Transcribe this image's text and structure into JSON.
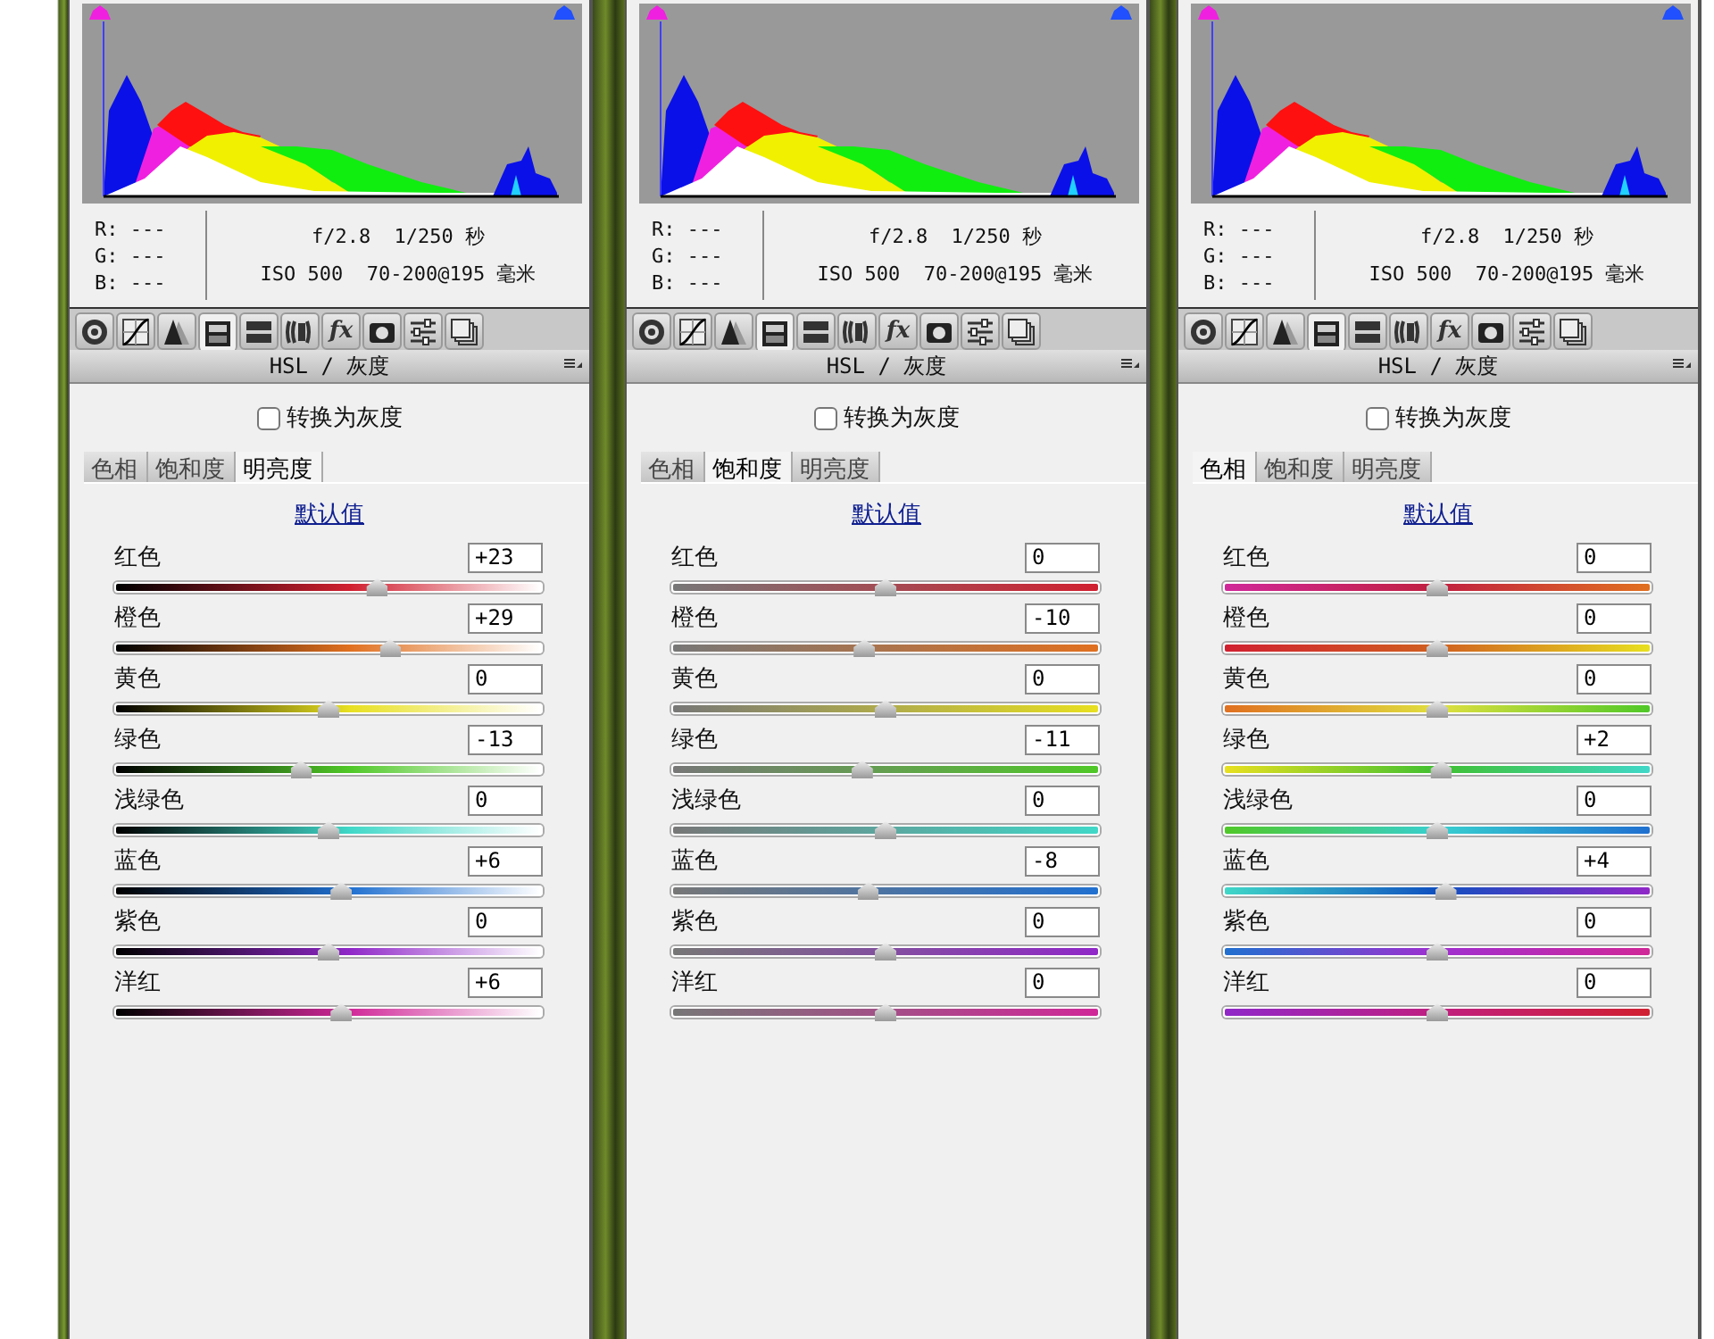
{
  "panels": [
    {
      "rgb": [
        "R: ---",
        "G: ---",
        "B: ---"
      ],
      "exposure": "f/2.8  1/250 秒",
      "camera": "ISO 500  70-200@195 毫米",
      "tools": [
        {
          "kind": "aperture",
          "selected": false
        },
        {
          "kind": "curve",
          "selected": false
        },
        {
          "kind": "peaks",
          "selected": false
        },
        {
          "kind": "hsl",
          "selected": true
        },
        {
          "kind": "split",
          "selected": false
        },
        {
          "kind": "lens",
          "selected": false
        },
        {
          "kind": "fx",
          "label": "fx",
          "selected": false
        },
        {
          "kind": "camera",
          "selected": false
        },
        {
          "kind": "presets",
          "selected": false
        },
        {
          "kind": "snapshots",
          "selected": false
        }
      ],
      "section_title": "HSL / 灰度",
      "grayscale": {
        "label": "转换为灰度",
        "checked": false
      },
      "tabs": [
        {
          "label": "色相",
          "selected": false
        },
        {
          "label": "饱和度",
          "selected": false
        },
        {
          "label": "明亮度",
          "selected": true
        }
      ],
      "default_link": "默认值",
      "sliders": [
        {
          "label": "红色",
          "value": "+23",
          "level": 0.615
        },
        {
          "label": "橙色",
          "value": "+29",
          "level": 0.645
        },
        {
          "label": "黄色",
          "value": "0",
          "level": 0.5
        },
        {
          "label": "绿色",
          "value": "-13",
          "level": 0.435
        },
        {
          "label": "浅绿色",
          "value": "0",
          "level": 0.5
        },
        {
          "label": "蓝色",
          "value": "+6",
          "level": 0.53
        },
        {
          "label": "紫色",
          "value": "0",
          "level": 0.5
        },
        {
          "label": "洋红",
          "value": "+6",
          "level": 0.53
        }
      ]
    },
    {
      "rgb": [
        "R: ---",
        "G: ---",
        "B: ---"
      ],
      "exposure": "f/2.8  1/250 秒",
      "camera": "ISO 500  70-200@195 毫米",
      "tools": [
        {
          "kind": "aperture",
          "selected": false
        },
        {
          "kind": "curve",
          "selected": false
        },
        {
          "kind": "peaks",
          "selected": false
        },
        {
          "kind": "hsl",
          "selected": true
        },
        {
          "kind": "split",
          "selected": false
        },
        {
          "kind": "lens",
          "selected": false
        },
        {
          "kind": "fx",
          "label": "fx",
          "selected": false
        },
        {
          "kind": "camera",
          "selected": false
        },
        {
          "kind": "presets",
          "selected": false
        },
        {
          "kind": "snapshots",
          "selected": false
        }
      ],
      "section_title": "HSL / 灰度",
      "grayscale": {
        "label": "转换为灰度",
        "checked": false
      },
      "tabs": [
        {
          "label": "色相",
          "selected": false
        },
        {
          "label": "饱和度",
          "selected": true
        },
        {
          "label": "明亮度",
          "selected": false
        }
      ],
      "default_link": "默认值",
      "sliders": [
        {
          "label": "红色",
          "value": "0",
          "level": 0.5
        },
        {
          "label": "橙色",
          "value": "-10",
          "level": 0.45
        },
        {
          "label": "黄色",
          "value": "0",
          "level": 0.5
        },
        {
          "label": "绿色",
          "value": "-11",
          "level": 0.445
        },
        {
          "label": "浅绿色",
          "value": "0",
          "level": 0.5
        },
        {
          "label": "蓝色",
          "value": "-8",
          "level": 0.46
        },
        {
          "label": "紫色",
          "value": "0",
          "level": 0.5
        },
        {
          "label": "洋红",
          "value": "0",
          "level": 0.5
        }
      ]
    },
    {
      "rgb": [
        "R: ---",
        "G: ---",
        "B: ---"
      ],
      "exposure": "f/2.8  1/250 秒",
      "camera": "ISO 500  70-200@195 毫米",
      "tools": [
        {
          "kind": "aperture",
          "selected": false
        },
        {
          "kind": "curve",
          "selected": false
        },
        {
          "kind": "peaks",
          "selected": false
        },
        {
          "kind": "hsl",
          "selected": true
        },
        {
          "kind": "split",
          "selected": false
        },
        {
          "kind": "lens",
          "selected": false
        },
        {
          "kind": "fx",
          "label": "fx",
          "selected": false
        },
        {
          "kind": "camera",
          "selected": false
        },
        {
          "kind": "presets",
          "selected": false
        },
        {
          "kind": "snapshots",
          "selected": false
        }
      ],
      "section_title": "HSL / 灰度",
      "grayscale": {
        "label": "转换为灰度",
        "checked": false
      },
      "tabs": [
        {
          "label": "色相",
          "selected": true
        },
        {
          "label": "饱和度",
          "selected": false
        },
        {
          "label": "明亮度",
          "selected": false
        }
      ],
      "default_link": "默认值",
      "sliders": [
        {
          "label": "红色",
          "value": "0",
          "level": 0.5
        },
        {
          "label": "橙色",
          "value": "0",
          "level": 0.5
        },
        {
          "label": "黄色",
          "value": "0",
          "level": 0.5
        },
        {
          "label": "绿色",
          "value": "+2",
          "level": 0.51
        },
        {
          "label": "浅绿色",
          "value": "0",
          "level": 0.5
        },
        {
          "label": "蓝色",
          "value": "+4",
          "level": 0.52
        },
        {
          "label": "紫色",
          "value": "0",
          "level": 0.5
        },
        {
          "label": "洋红",
          "value": "0",
          "level": 0.5
        }
      ]
    }
  ]
}
